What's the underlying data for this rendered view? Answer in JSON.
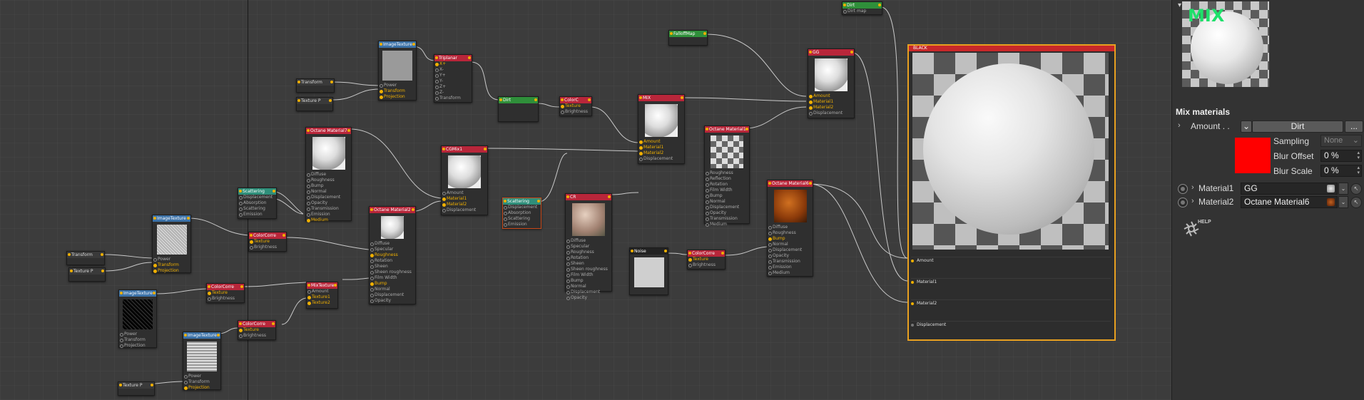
{
  "canvas": {
    "nodes": {
      "dirt_top": {
        "title": "Dirt",
        "pins": [
          "Dirt map"
        ]
      },
      "transform1": {
        "title": "Transform"
      },
      "texture_p1": {
        "title": "Texture P"
      },
      "imagetexture1": {
        "title": "ImageTexture",
        "pins": [
          "Power",
          "Transform",
          "Projection"
        ]
      },
      "triplanar": {
        "title": "Triplanar",
        "pins": [
          "X+",
          "X-",
          "Y+",
          "Y-",
          "Z+",
          "Z-",
          "Transform"
        ]
      },
      "falloffmap": {
        "title": "FalloffMap"
      },
      "dirt_mid": {
        "title": "Dirt"
      },
      "colorc1": {
        "title": "ColorC",
        "pins": [
          "Texture",
          "Brightness"
        ]
      },
      "mix_node": {
        "title": "MIX",
        "pins": [
          "Amount",
          "Material1",
          "Material2",
          "Displacement"
        ]
      },
      "gg": {
        "title": "GG",
        "pins": [
          "Amount",
          "Material1",
          "Material2",
          "Displacement"
        ]
      },
      "octane_mat1": {
        "title": "Octane Material1",
        "pins": [
          "Roughness",
          "Reflection",
          "Rotation",
          "Film Width",
          "Bump",
          "Normal",
          "Displacement",
          "Opacity",
          "Transmission",
          "Medium"
        ]
      },
      "octane_mat7": {
        "title": "Octane Material7",
        "pins": [
          "Diffuse",
          "Roughness",
          "Bump",
          "Normal",
          "Displacement",
          "Opacity",
          "Transmission",
          "Emission",
          "Medium"
        ]
      },
      "cgmix1": {
        "title": "CGMix1",
        "pins": [
          "Amount",
          "Material1",
          "Material2",
          "Displacement"
        ]
      },
      "scattering1": {
        "title": "Scattering",
        "pins": [
          "Displacement",
          "Absorption",
          "Scattering",
          "Emission"
        ]
      },
      "scattering2": {
        "title": "Scattering",
        "pins": [
          "Displacement",
          "Absorption",
          "Scattering",
          "Emission"
        ]
      },
      "cr": {
        "title": "CR",
        "pins": [
          "Diffuse",
          "Specular",
          "Roughness",
          "Rotation",
          "Sheen",
          "Sheen roughness",
          "Film Width",
          "Bump",
          "Normal",
          "Displacement",
          "Opacity"
        ]
      },
      "octane_mat6": {
        "title": "Octane Material6",
        "pins": [
          "Diffuse",
          "Roughness",
          "Bump",
          "Normal",
          "Displacement",
          "Opacity",
          "Transmission",
          "Emission",
          "Medium"
        ]
      },
      "imagetexture2": {
        "title": "ImageTexture",
        "pins": [
          "Power",
          "Transform",
          "Projection"
        ]
      },
      "colorcorre1": {
        "title": "ColorCorre",
        "pins": [
          "Texture",
          "Brightness"
        ]
      },
      "transform2": {
        "title": "Transform"
      },
      "texture_p2": {
        "title": "Texture P"
      },
      "octane_mat2": {
        "title": "Octane Material2",
        "pins": [
          "Diffuse",
          "Specular",
          "Roughness",
          "Rotation",
          "Sheen",
          "Sheen roughness",
          "Film Width",
          "Bump",
          "Normal",
          "Displacement",
          "Opacity"
        ]
      },
      "imagetexture3": {
        "title": "ImageTexture",
        "pins": [
          "Power",
          "Transform",
          "Projection"
        ]
      },
      "colorcorre2": {
        "title": "ColorCorre",
        "pins": [
          "Texture",
          "Brightness"
        ]
      },
      "mixtexture": {
        "title": "MixTexture",
        "pins": [
          "Amount",
          "Texture1",
          "Texture2"
        ]
      },
      "colorcorre3": {
        "title": "ColorCorre",
        "pins": [
          "Texture",
          "Brightness"
        ]
      },
      "imagetexture4": {
        "title": "ImageTexture",
        "pins": [
          "Power",
          "Transform",
          "Projection"
        ]
      },
      "texture_p3": {
        "title": "Texture P"
      },
      "noise": {
        "title": "Noise"
      },
      "colorcorre4": {
        "title": "ColorCorre",
        "pins": [
          "Texture",
          "Brightness"
        ]
      }
    },
    "preview": {
      "title": "BLACK",
      "pins": [
        "Amount",
        "Material1",
        "Material2",
        "Displacement"
      ]
    }
  },
  "panel": {
    "thumb_label": "MIX",
    "section_title": "Mix materials",
    "amount": {
      "label": "Amount . .",
      "value": "Dirt",
      "more": "..."
    },
    "sampling": {
      "label": "Sampling",
      "value": "None"
    },
    "blur_offset": {
      "label": "Blur Offset",
      "value": "0 %"
    },
    "blur_scale": {
      "label": "Blur Scale",
      "value": "0 %"
    },
    "material1": {
      "label": "Material1",
      "value": "GG"
    },
    "material2": {
      "label": "Material2",
      "value": "Octane Material6"
    },
    "help_label": "HELP",
    "colors": {
      "amount_color": "#ff0000",
      "accent": "#f0b000",
      "header_red": "#c8282a"
    }
  }
}
